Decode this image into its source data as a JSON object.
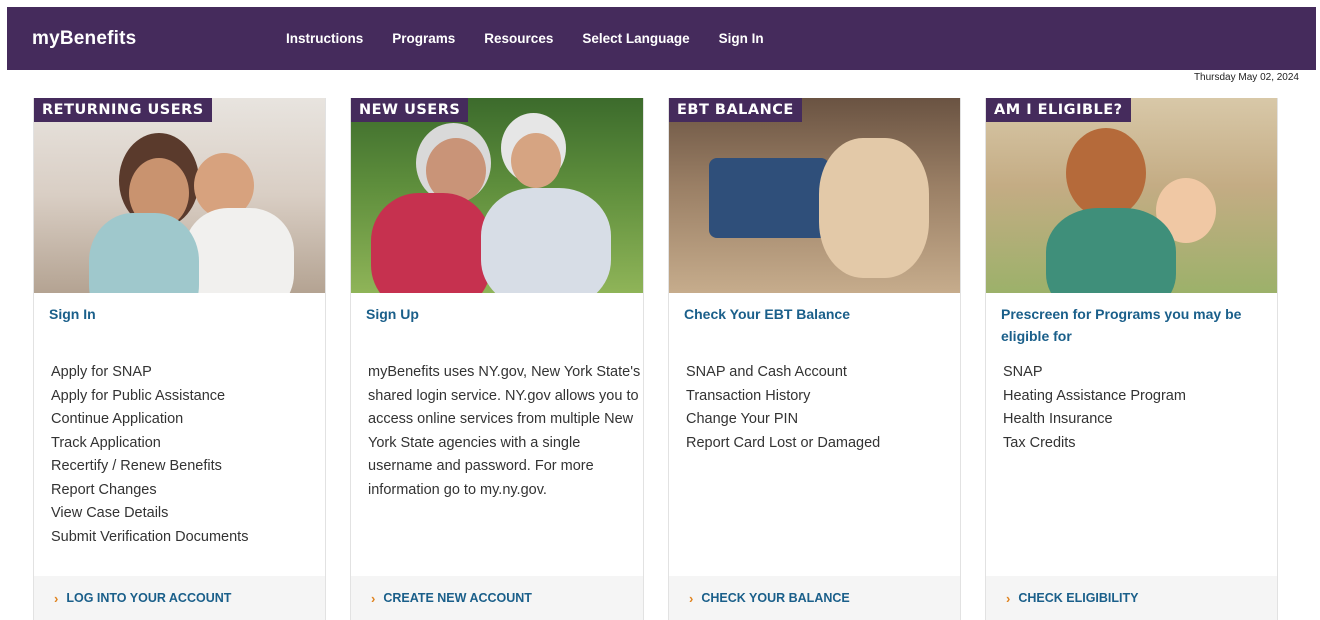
{
  "brand": "myBenefits",
  "nav": [
    "Instructions",
    "Programs",
    "Resources",
    "Select Language",
    "Sign In"
  ],
  "date": "Thursday May 02, 2024",
  "cards": [
    {
      "tag": "RETURNING USERS",
      "head_link": "Sign In",
      "items": [
        "Apply for SNAP",
        "Apply for Public Assistance",
        "Continue Application",
        "Track Application",
        "Recertify / Renew Benefits",
        "Report Changes",
        "View Case Details",
        "Submit Verification Documents"
      ],
      "cta": "LOG INTO YOUR ACCOUNT"
    },
    {
      "tag": "NEW USERS",
      "head_link": "Sign Up",
      "desc": "myBenefits uses NY.gov, New York State's shared login service. NY.gov allows you to access online services from multiple New York State agencies with a single username and password. For more information go to my.ny.gov.",
      "cta": "CREATE NEW ACCOUNT"
    },
    {
      "tag": "EBT BALANCE",
      "head_link": "Check Your EBT Balance",
      "items": [
        "SNAP and Cash Account",
        "Transaction History",
        "Change Your PIN",
        "Report Card Lost or Damaged"
      ],
      "cta": "CHECK YOUR BALANCE"
    },
    {
      "tag": "AM I ELIGIBLE?",
      "head_link": "Prescreen for Programs you may be eligible for",
      "items": [
        "SNAP",
        "Heating Assistance Program",
        "Health Insurance",
        "Tax Credits"
      ],
      "cta": "CHECK ELIGIBILITY"
    }
  ],
  "colors": {
    "header": "#452b5c",
    "link": "#1a5f8a",
    "chevron": "#e0831f"
  }
}
